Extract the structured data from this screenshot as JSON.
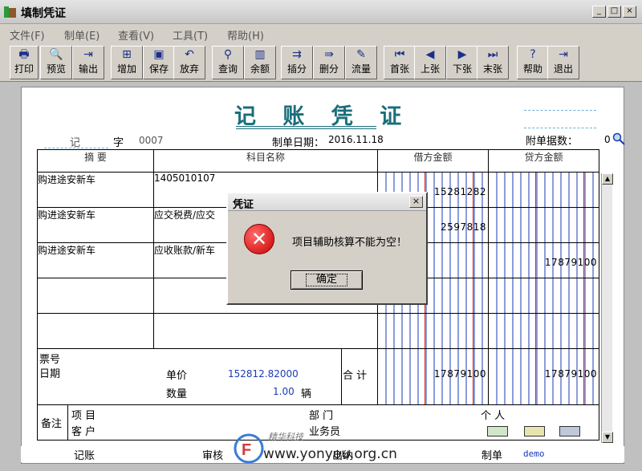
{
  "window": {
    "title": "填制凭证"
  },
  "menu": [
    "文件(F)",
    "制单(E)",
    "查看(V)",
    "工具(T)",
    "帮助(H)"
  ],
  "toolbar": [
    {
      "label": "打印",
      "icon": "printer-icon",
      "glyph": "🖶"
    },
    {
      "label": "预览",
      "icon": "preview-icon",
      "glyph": "🔍"
    },
    {
      "label": "输出",
      "icon": "export-icon",
      "glyph": "⇥"
    },
    {
      "label": "增加",
      "icon": "add-icon",
      "glyph": "⊞"
    },
    {
      "label": "保存",
      "icon": "save-icon",
      "glyph": "▣"
    },
    {
      "label": "放弃",
      "icon": "undo-icon",
      "glyph": "↶"
    },
    {
      "label": "查询",
      "icon": "binoculars-icon",
      "glyph": "⚲"
    },
    {
      "label": "余额",
      "icon": "bar-chart-icon",
      "glyph": "▥"
    },
    {
      "label": "插分",
      "icon": "insert-row-icon",
      "glyph": "⇉"
    },
    {
      "label": "删分",
      "icon": "delete-row-icon",
      "glyph": "⇛"
    },
    {
      "label": "流量",
      "icon": "flow-icon",
      "glyph": "✎"
    },
    {
      "label": "首张",
      "icon": "first-icon",
      "glyph": "⏮"
    },
    {
      "label": "上张",
      "icon": "prev-icon",
      "glyph": "◀"
    },
    {
      "label": "下张",
      "icon": "next-icon",
      "glyph": "▶"
    },
    {
      "label": "末张",
      "icon": "last-icon",
      "glyph": "⏭"
    },
    {
      "label": "帮助",
      "icon": "help-icon",
      "glyph": "?"
    },
    {
      "label": "退出",
      "icon": "exit-icon",
      "glyph": "⇥"
    }
  ],
  "voucher": {
    "title": "记 账 凭 证",
    "type": "记",
    "zi": "字",
    "number": "0007",
    "date_label": "制单日期：",
    "date": "2016.11.18",
    "attach_label": "附单据数：",
    "attach_count": "0",
    "headers": {
      "summary": "摘 要",
      "account": "科目名称",
      "debit": "借方金额",
      "credit": "贷方金额"
    },
    "rows": [
      {
        "summary": "购进途安新车",
        "account": "1405010107",
        "debit": "15281282",
        "credit": ""
      },
      {
        "summary": "购进途安新车",
        "account": "应交税费/应交",
        "debit": "2597818",
        "credit": ""
      },
      {
        "summary": "购进途安新车",
        "account": "应收账款/新车",
        "debit": "",
        "credit": "17879100"
      },
      {
        "summary": "",
        "account": "",
        "debit": "",
        "credit": ""
      },
      {
        "summary": "",
        "account": "",
        "debit": "",
        "credit": ""
      }
    ],
    "bill_no_label": "票号",
    "bill_date_label": "日期",
    "unit_price_label": "单价",
    "unit_price": "152812.82000",
    "qty_label": "数量",
    "qty": "1.00",
    "qty_unit": "辆",
    "total_label": "合 计",
    "total_debit": "17879100",
    "total_credit": "17879100",
    "remark_label": "备注",
    "project_label": "项 目",
    "dept_label": "部 门",
    "person_label": "个 人",
    "customer_label": "客 户",
    "salesman_label": "业务员",
    "bookkeep_label": "记账",
    "audit_label": "审核",
    "cashier_label": "出纳",
    "maker_label": "制单",
    "maker": "demo"
  },
  "dialog": {
    "title": "凭证",
    "message": "项目辅助核算不能为空！",
    "ok_label": "确定"
  },
  "watermark": {
    "brand": "精华科技",
    "url": "www.yonyou.org.cn"
  }
}
